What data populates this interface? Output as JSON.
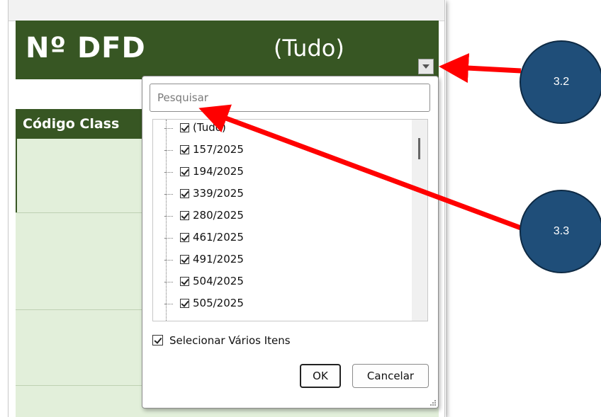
{
  "sheet": {
    "header_title": "Nº DFD",
    "header_filter_value": "(Tudo)",
    "column_header": "Código Class"
  },
  "filter_popup": {
    "search_placeholder": "Pesquisar",
    "items": [
      {
        "label": "(Tudo)",
        "checked": true
      },
      {
        "label": "157/2025",
        "checked": true
      },
      {
        "label": "194/2025",
        "checked": true
      },
      {
        "label": "339/2025",
        "checked": true
      },
      {
        "label": "280/2025",
        "checked": true
      },
      {
        "label": "461/2025",
        "checked": true
      },
      {
        "label": "491/2025",
        "checked": true
      },
      {
        "label": "504/2025",
        "checked": true
      },
      {
        "label": "505/2025",
        "checked": true
      }
    ],
    "multi_select_label": "Selecionar Vários Itens",
    "multi_select_checked": true,
    "ok_label": "OK",
    "cancel_label": "Cancelar"
  },
  "callouts": {
    "dropdown": "3.2",
    "search": "3.3"
  },
  "colors": {
    "header_green": "#375623",
    "cell_green": "#e2efda",
    "callout_blue": "#1f4e79",
    "arrow_red": "#ff0000"
  }
}
